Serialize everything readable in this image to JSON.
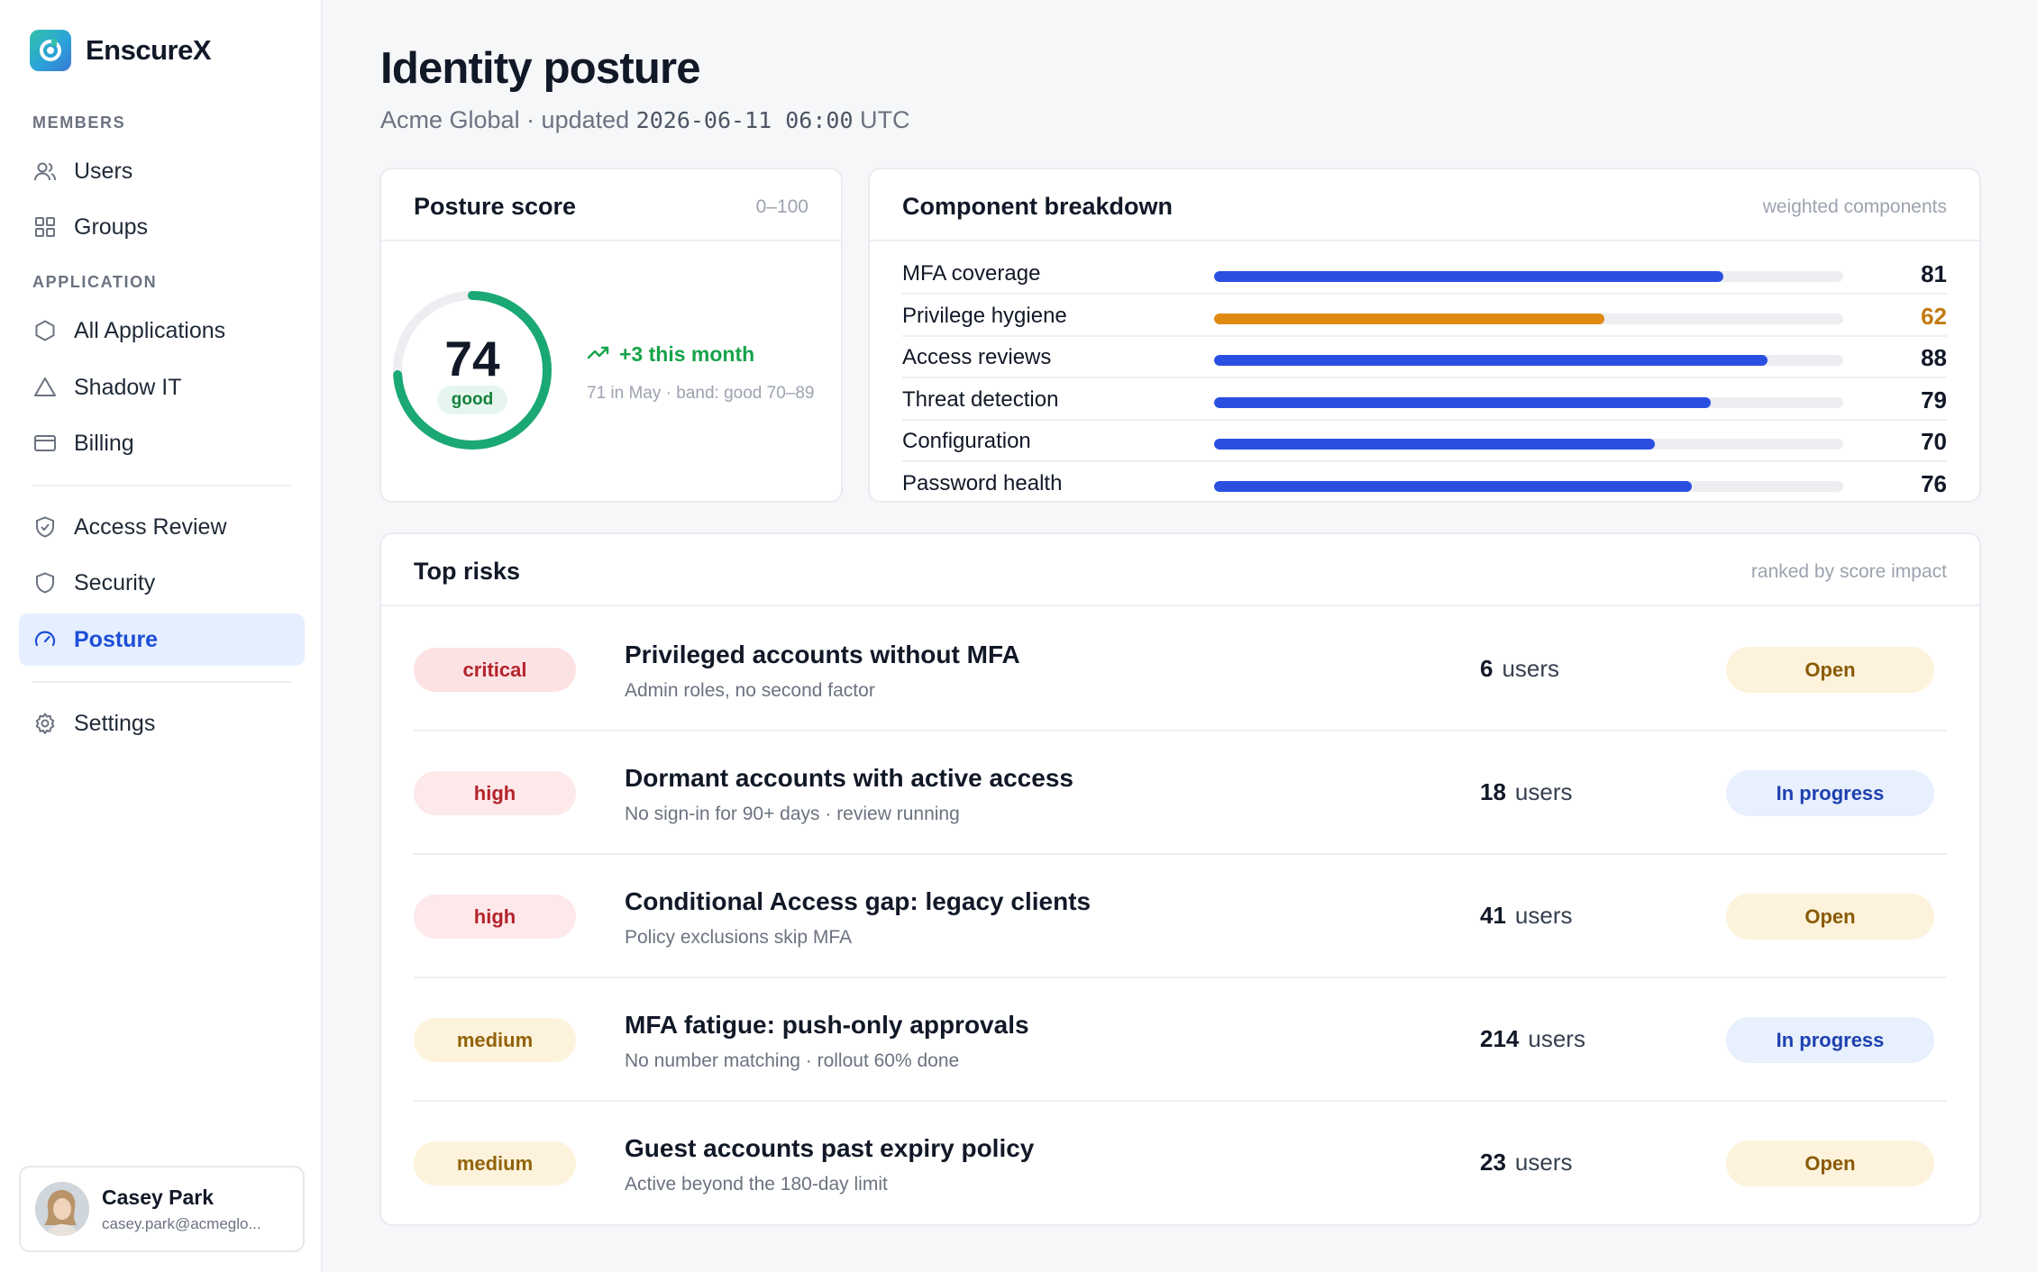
{
  "brand": {
    "name": "EnscureX"
  },
  "sidebar": {
    "sections": [
      {
        "label": "MEMBERS"
      },
      {
        "label": "APPLICATION"
      }
    ],
    "items": [
      {
        "label": "Users",
        "icon": "users-icon"
      },
      {
        "label": "Groups",
        "icon": "grid-icon"
      },
      {
        "label": "All Applications",
        "icon": "hexagon-icon"
      },
      {
        "label": "Shadow IT",
        "icon": "triangle-icon"
      },
      {
        "label": "Billing",
        "icon": "card-icon"
      },
      {
        "label": "Access Review",
        "icon": "shield-check-icon"
      },
      {
        "label": "Security",
        "icon": "shield-icon"
      },
      {
        "label": "Posture",
        "icon": "gauge-icon",
        "active": true
      },
      {
        "label": "Settings",
        "icon": "gear-icon"
      }
    ],
    "user": {
      "name": "Casey Park",
      "email": "casey.park@acmeglo..."
    }
  },
  "header": {
    "title": "Identity posture",
    "subtitle_prefix": "Acme Global · updated ",
    "subtitle_time": "2026-06-11 06:00",
    "subtitle_suffix": " UTC"
  },
  "score_card": {
    "title": "Posture score",
    "range": "0–100",
    "score": "74",
    "score_fraction": 0.74,
    "band": "good",
    "trend": "+3 this month",
    "note": "71 in May · band: good 70–89",
    "colors": {
      "arc": "#1aa874",
      "track": "#eceef2"
    }
  },
  "breakdown": {
    "title": "Component breakdown",
    "meta": "weighted components",
    "components": [
      {
        "name": "MFA coverage",
        "value": "81",
        "fraction": 0.81,
        "color": "#2a4fe0",
        "value_color": "#111827"
      },
      {
        "name": "Privilege hygiene",
        "value": "62",
        "fraction": 0.62,
        "color": "#e08a12",
        "value_color": "#c07a10"
      },
      {
        "name": "Access reviews",
        "value": "88",
        "fraction": 0.88,
        "color": "#2a4fe0",
        "value_color": "#111827"
      },
      {
        "name": "Threat detection",
        "value": "79",
        "fraction": 0.79,
        "color": "#2a4fe0",
        "value_color": "#111827"
      },
      {
        "name": "Configuration",
        "value": "70",
        "fraction": 0.7,
        "color": "#2a4fe0",
        "value_color": "#111827"
      },
      {
        "name": "Password health",
        "value": "76",
        "fraction": 0.76,
        "color": "#2a4fe0",
        "value_color": "#111827"
      }
    ]
  },
  "risks": {
    "title": "Top risks",
    "meta": "ranked by score impact",
    "rows": [
      {
        "severity": "critical",
        "title": "Privileged accounts without MFA",
        "desc": "Admin roles, no second factor",
        "count": "6",
        "unit": "users",
        "status": "Open",
        "status_kind": "open"
      },
      {
        "severity": "high",
        "title": "Dormant accounts with active access",
        "desc": "No sign-in for 90+ days · review running",
        "count": "18",
        "unit": "users",
        "status": "In progress",
        "status_kind": "prog"
      },
      {
        "severity": "high",
        "title": "Conditional Access gap: legacy clients",
        "desc": "Policy exclusions skip MFA",
        "count": "41",
        "unit": "users",
        "status": "Open",
        "status_kind": "open"
      },
      {
        "severity": "medium",
        "title": "MFA fatigue: push-only approvals",
        "desc": "No number matching · rollout 60% done",
        "count": "214",
        "unit": "users",
        "status": "In progress",
        "status_kind": "prog"
      },
      {
        "severity": "medium",
        "title": "Guest accounts past expiry policy",
        "desc": "Active beyond the 180-day limit",
        "count": "23",
        "unit": "users",
        "status": "Open",
        "status_kind": "open"
      }
    ]
  }
}
